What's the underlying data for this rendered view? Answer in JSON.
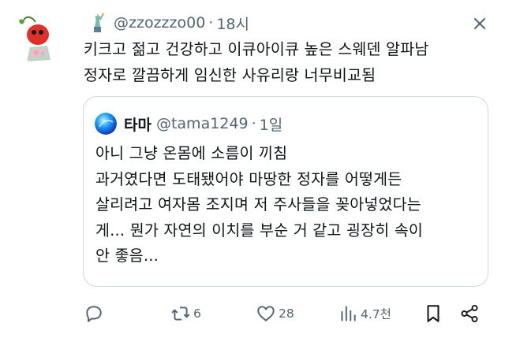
{
  "tweet": {
    "handle": "@zzozzzo00",
    "separator": "·",
    "time": "18시",
    "text": "키크고 젊고 건강하고 이큐아이큐 높은 스웨덴 알파남\n정자로 깔끔하게 임신한 사유리랑 너무비교됨"
  },
  "quoted": {
    "name": "타마",
    "handle": "@tama1249",
    "separator": "·",
    "time": "1일",
    "text": "아니 그냥 온몸에 소름이 끼침\n과거였다면 도태됐어야 마땅한 정자를 어떻게든\n살리려고 여자몸 조지며 저 주사들을 꽂아넣었다는\n게... 뭔가 자연의 이치를 부순 거 같고 굉장히 속이\n안 좋음..."
  },
  "actions": {
    "retweets": "6",
    "likes": "28",
    "views": "4.7천"
  },
  "colors": {
    "text": "#0f1419",
    "secondary": "#536471",
    "border": "#cfd9de"
  },
  "icons": [
    "avatar-pikmin",
    "statue-of-liberty-emoji",
    "close-icon",
    "quoted-avatar-blue-orb",
    "reply-icon",
    "retweet-icon",
    "like-icon",
    "views-icon",
    "bookmark-icon",
    "share-icon"
  ]
}
